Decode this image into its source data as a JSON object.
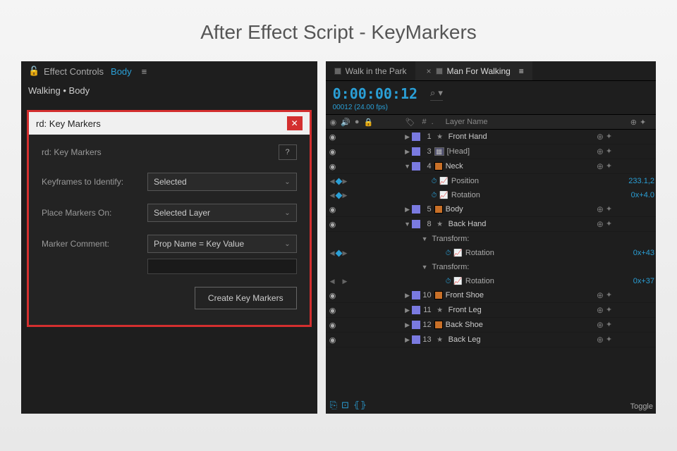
{
  "page_title": "After Effect Script - KeyMarkers",
  "left": {
    "fx_label": "Effect Controls",
    "fx_link": "Body",
    "breadcrumb": "Walking • Body",
    "dialog": {
      "title": "rd: Key Markers",
      "subtitle": "rd: Key Markers",
      "help": "?",
      "rows": {
        "keyframes_label": "Keyframes to Identify:",
        "keyframes_value": "Selected",
        "place_label": "Place Markers On:",
        "place_value": "Selected Layer",
        "comment_label": "Marker Comment:",
        "comment_value": "Prop Name = Key Value"
      },
      "create_btn": "Create Key Markers"
    }
  },
  "right": {
    "tabs": {
      "inactive": "Walk in the Park",
      "active": "Man For Walking"
    },
    "timecode": "0:00:00:12",
    "frames": "00012 (24.00 fps)",
    "header": {
      "num": "#",
      "dot": ".",
      "name": "Layer Name"
    },
    "layers": [
      {
        "idx": "1",
        "type": "star",
        "name": "Front Hand",
        "val": ""
      },
      {
        "idx": "3",
        "type": "comp",
        "name": "[Head]",
        "val": ""
      },
      {
        "idx": "4",
        "type": "solid",
        "name": "Neck",
        "expanded": true,
        "val": ""
      },
      {
        "prop": true,
        "kf": true,
        "name": "Position",
        "val": "233.1,2"
      },
      {
        "prop": true,
        "kf": true,
        "name": "Rotation",
        "val": "0x+4.0"
      },
      {
        "idx": "5",
        "type": "solid",
        "name": "Body",
        "val": ""
      },
      {
        "idx": "8",
        "type": "star",
        "name": "Back Hand",
        "expanded": true,
        "val": ""
      },
      {
        "transform": true,
        "name": "Transform:"
      },
      {
        "prop": true,
        "kf": true,
        "name": "Rotation",
        "val": "0x+43",
        "deep": true
      },
      {
        "transform": true,
        "name": "Transform:"
      },
      {
        "prop": true,
        "kf": false,
        "name": "Rotation",
        "val": "0x+37",
        "deep": true
      },
      {
        "idx": "10",
        "type": "solid",
        "name": "Front Shoe",
        "val": ""
      },
      {
        "idx": "11",
        "type": "star",
        "name": "Front Leg",
        "val": ""
      },
      {
        "idx": "12",
        "type": "solid",
        "name": "Back Shoe",
        "val": ""
      },
      {
        "idx": "13",
        "type": "star",
        "name": "Back Leg",
        "val": ""
      }
    ],
    "toggle": "Toggle"
  }
}
